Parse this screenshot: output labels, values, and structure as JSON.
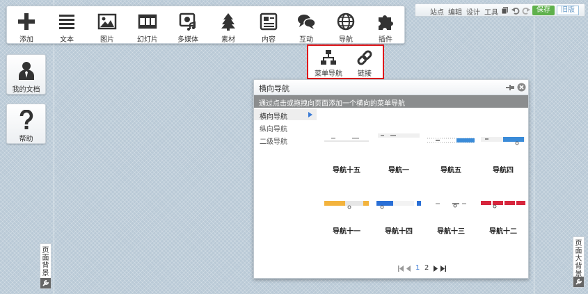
{
  "toolbar": {
    "items": [
      {
        "label": "添加",
        "icon": "plus-icon"
      },
      {
        "label": "文本",
        "icon": "text-lines-icon"
      },
      {
        "label": "图片",
        "icon": "image-icon"
      },
      {
        "label": "幻灯片",
        "icon": "filmstrip-icon"
      },
      {
        "label": "多媒体",
        "icon": "multimedia-icon"
      },
      {
        "label": "素材",
        "icon": "tree-icon"
      },
      {
        "label": "内容",
        "icon": "content-icon"
      },
      {
        "label": "互动",
        "icon": "chat-bubbles-icon"
      },
      {
        "label": "导航",
        "icon": "globe-icon"
      },
      {
        "label": "插件",
        "icon": "puzzle-icon"
      }
    ]
  },
  "subtoolbar": {
    "items": [
      {
        "label": "菜单导航",
        "icon": "sitemap-icon"
      },
      {
        "label": "链接",
        "icon": "link-icon"
      }
    ]
  },
  "topmenu": {
    "links": [
      "站点",
      "编辑",
      "设计",
      "工具"
    ],
    "save_label": "保存",
    "old_label": "旧版"
  },
  "sidebar": {
    "my_docs_label": "我的文档",
    "help_label": "帮助"
  },
  "page_background_tab": "页面背景",
  "page_big_background_tab": "页面大背景",
  "panel": {
    "title": "横向导航",
    "hint": "通过点击或拖拽向页面添加一个横向的菜单导航",
    "categories": [
      "横向导航",
      "纵向导航",
      "二级导航"
    ],
    "active_category": "横向导航",
    "thumbnails": [
      {
        "name": "导航十五"
      },
      {
        "name": "导航一"
      },
      {
        "name": "导航五"
      },
      {
        "name": "导航四"
      },
      {
        "name": "导航十一"
      },
      {
        "name": "导航十四"
      },
      {
        "name": "导航十三"
      },
      {
        "name": "导航十二"
      }
    ],
    "pages": [
      "1",
      "2"
    ],
    "current_page": "1"
  },
  "colors": {
    "accent_red": "#e0161b",
    "save_green": "#5fb14c",
    "panel_bar": "#8b8d8e",
    "link_blue": "#3a7bd5"
  }
}
